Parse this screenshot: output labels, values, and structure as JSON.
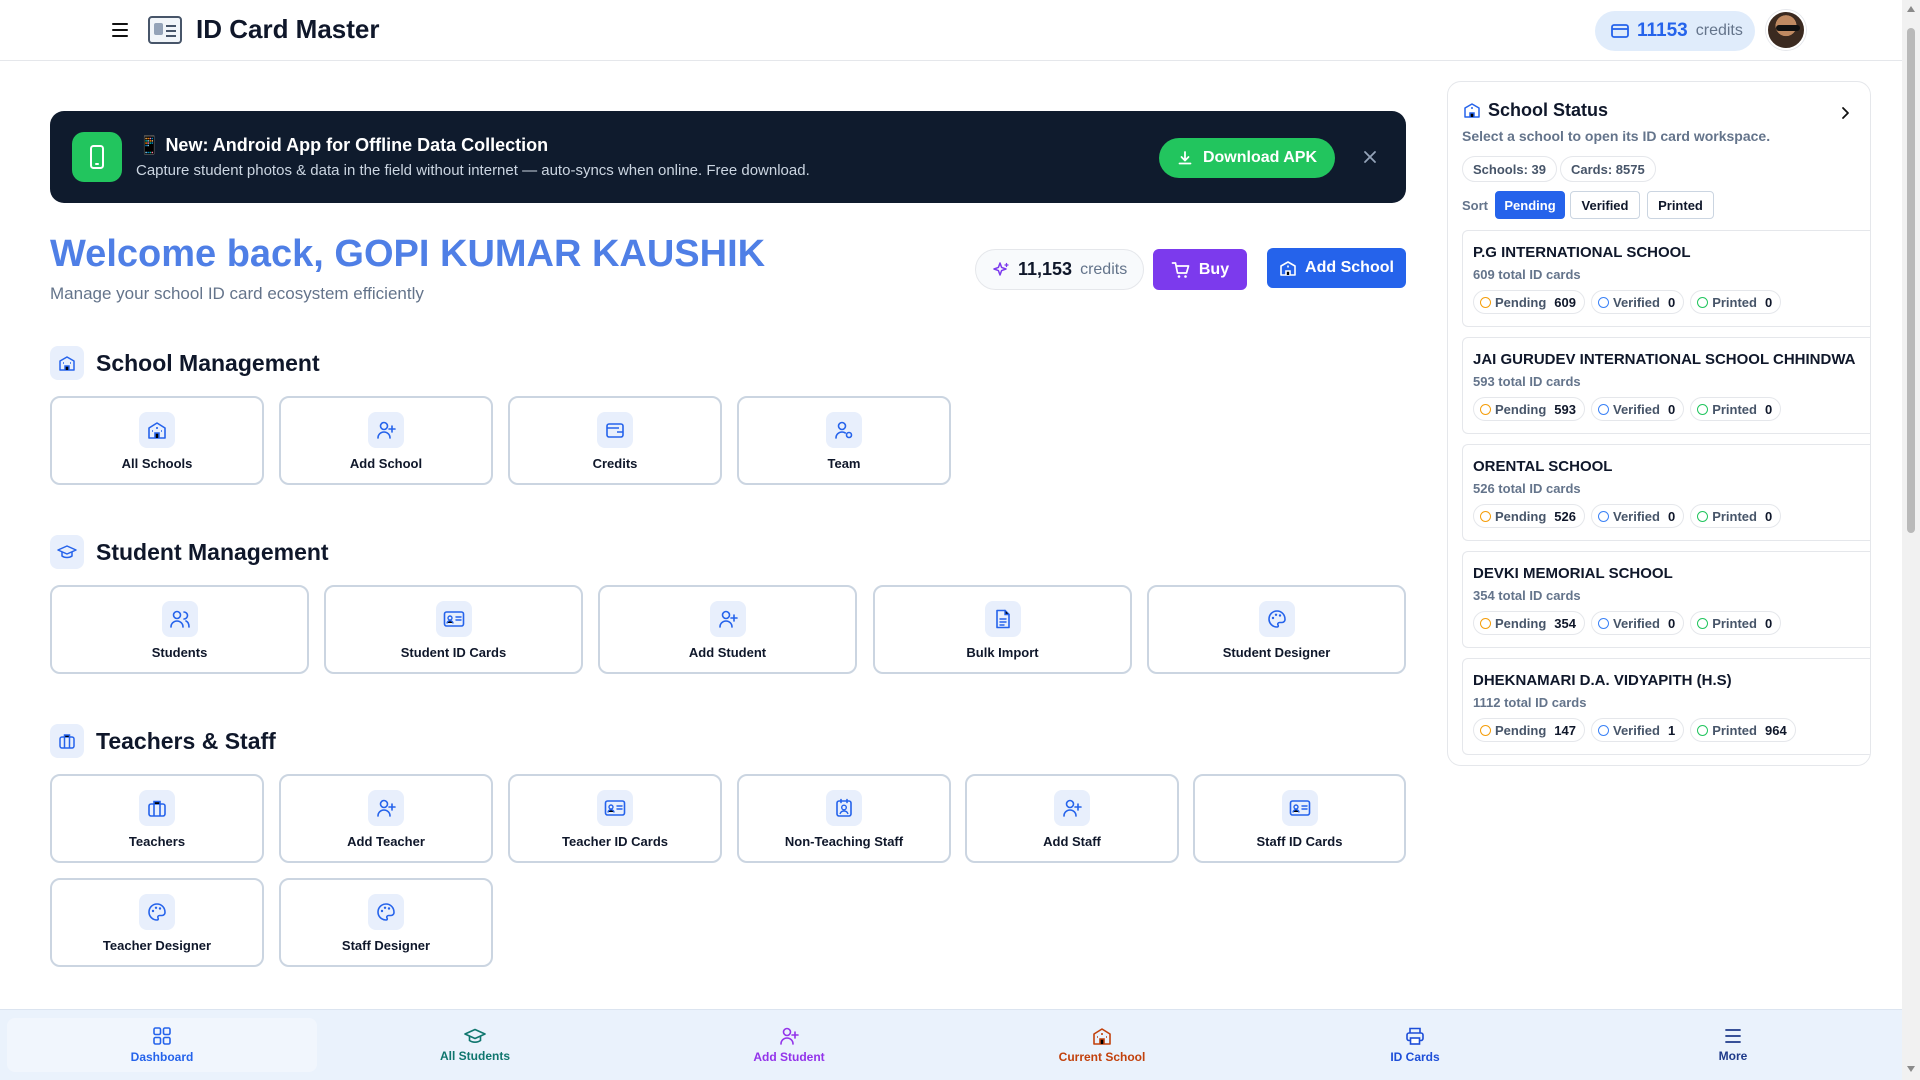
{
  "header": {
    "app_title": "ID Card Master",
    "credits_value": "11153",
    "credits_label": "credits"
  },
  "banner": {
    "emoji": "📱",
    "title": "New: Android App for Offline Data Collection",
    "subtitle": "Capture student photos & data in the field without internet — auto-syncs when online. Free download.",
    "download_label": "Download APK"
  },
  "welcome": {
    "title": "Welcome back, GOPI KUMAR KAUSHIK",
    "subtitle": "Manage your school ID card ecosystem efficiently",
    "credits_value": "11,153",
    "credits_label": "credits",
    "buy_label": "Buy",
    "add_school_label": "Add School"
  },
  "sections": {
    "school_management": {
      "title": "School Management",
      "tiles": [
        "All Schools",
        "Add School",
        "Credits",
        "Team"
      ]
    },
    "student_management": {
      "title": "Student Management",
      "tiles": [
        "Students",
        "Student ID Cards",
        "Add Student",
        "Bulk Import",
        "Student Designer"
      ]
    },
    "teachers_staff": {
      "title": "Teachers & Staff",
      "tiles": [
        "Teachers",
        "Add Teacher",
        "Teacher ID Cards",
        "Non-Teaching Staff",
        "Add Staff",
        "Staff ID Cards",
        "Teacher Designer",
        "Staff Designer"
      ]
    }
  },
  "school_status": {
    "title": "School Status",
    "subtitle": "Select a school to open its ID card workspace.",
    "schools_count": "Schools: 39",
    "cards_count": "Cards: 8575",
    "sort_label": "Sort",
    "sort_options": [
      "Pending",
      "Verified",
      "Printed"
    ],
    "badge_labels": {
      "pending": "Pending",
      "verified": "Verified",
      "printed": "Printed"
    },
    "schools": [
      {
        "name": "P.G INTERNATIONAL SCHOOL",
        "total": "609 total ID cards",
        "pending": "609",
        "verified": "0",
        "printed": "0"
      },
      {
        "name": "JAI GURUDEV INTERNATIONAL SCHOOL CHHINDWA",
        "total": "593 total ID cards",
        "pending": "593",
        "verified": "0",
        "printed": "0"
      },
      {
        "name": "ORENTAL SCHOOL",
        "total": "526 total ID cards",
        "pending": "526",
        "verified": "0",
        "printed": "0"
      },
      {
        "name": "DEVKI MEMORIAL SCHOOL",
        "total": "354 total ID cards",
        "pending": "354",
        "verified": "0",
        "printed": "0"
      },
      {
        "name": "DHEKNAMARI D.A. VIDYAPITH (H.S)",
        "total": "1112 total ID cards",
        "pending": "147",
        "verified": "1",
        "printed": "964"
      }
    ]
  },
  "bottom_nav": {
    "items": [
      "Dashboard",
      "All Students",
      "Add Student",
      "Current School",
      "ID Cards",
      "More"
    ]
  },
  "colors": {
    "primary": "#2563eb",
    "buy": "#7c3aed",
    "success": "#22c55e",
    "banner_bg": "#0f1b2d",
    "nav_dashboard": "#2563eb",
    "nav_all_students": "#0f766e",
    "nav_add_student": "#9333ea",
    "nav_current_school": "#c2410c",
    "nav_id_cards": "#1d4ed8",
    "nav_more": "#1e3a8a"
  }
}
